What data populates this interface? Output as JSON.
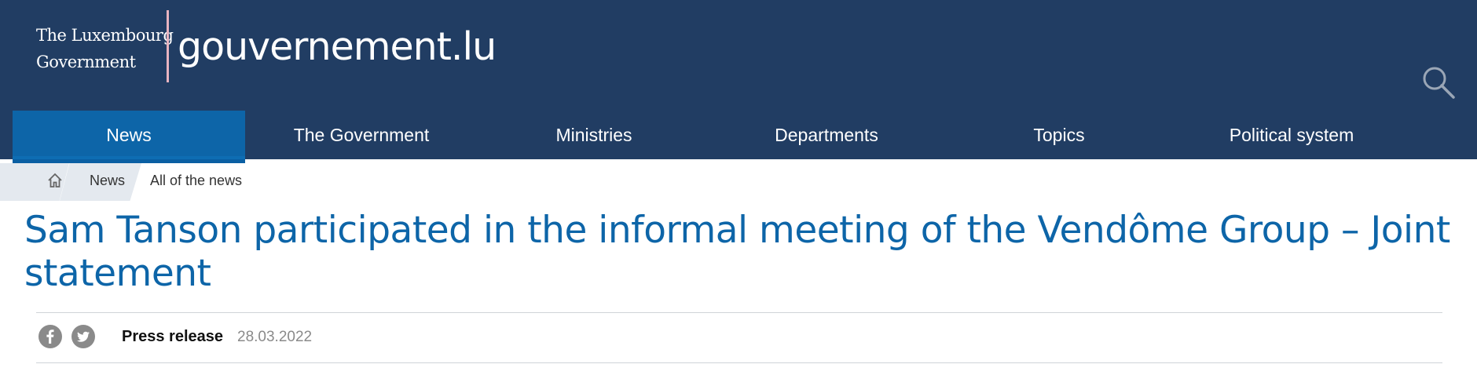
{
  "header": {
    "government_line1": "The Luxembourg",
    "government_line2": "Government",
    "site_name": "gouvernement.lu"
  },
  "nav": {
    "items": [
      {
        "label": "News",
        "active": true
      },
      {
        "label": "The Government"
      },
      {
        "label": "Ministries"
      },
      {
        "label": "Departments"
      },
      {
        "label": "Topics"
      },
      {
        "label": "Political system"
      }
    ]
  },
  "breadcrumb": {
    "news": "News",
    "current": "All of the news"
  },
  "article": {
    "title": "Sam Tanson participated in the informal meeting of the Vendôme Group – Joint statement",
    "type": "Press release",
    "date": "28.03.2022"
  },
  "icons": {
    "search": "search-icon",
    "home": "home-icon",
    "facebook": "facebook-icon",
    "twitter": "twitter-icon"
  },
  "colors": {
    "header_bg": "#213d63",
    "accent": "#0d65a8",
    "brand_divider": "#e8b4c0"
  }
}
